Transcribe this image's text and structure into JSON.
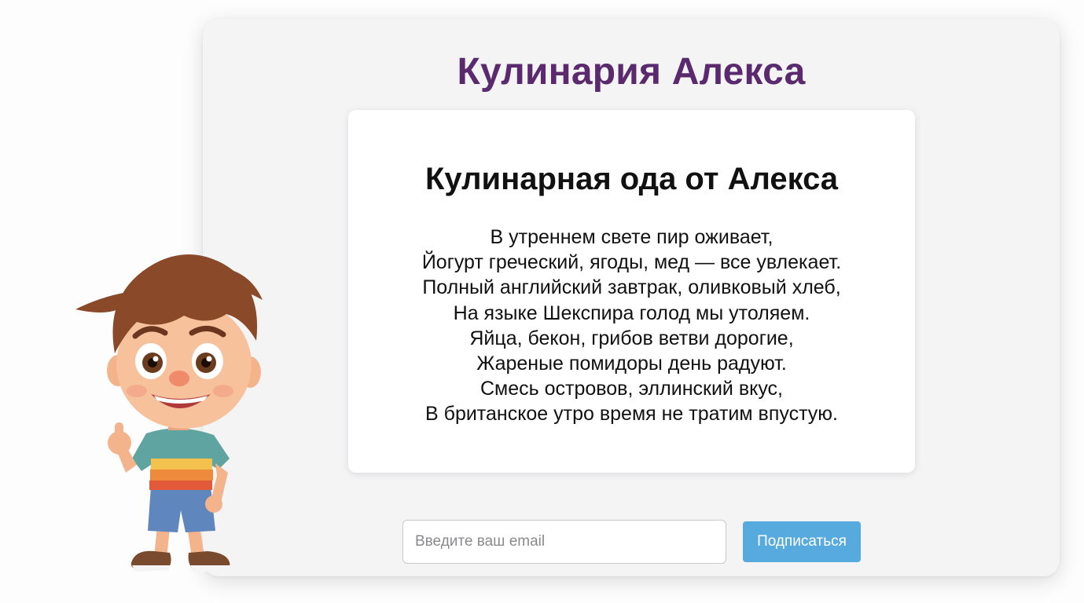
{
  "header": {
    "title": "Кулинария Алекса"
  },
  "poem": {
    "title": "Кулинарная ода от Алекса",
    "lines": [
      "В утреннем свете пир оживает,",
      "Йогурт греческий, ягоды, мед — все увлекает.",
      "Полный английский завтрак, оливковый хлеб,",
      "На языке Шекспира голод мы утоляем.",
      "Яйца, бекон, грибов ветви дорогие,",
      "Жареные помидоры день радуют.",
      "Смесь островов, эллинский вкус,",
      "В британское утро время не тратим впустую."
    ]
  },
  "subscribe": {
    "email_placeholder": "Введите ваш email",
    "button_label": "Подписаться"
  },
  "colors": {
    "title": "#5b2a6e",
    "button": "#57aadd",
    "panel": "#f4f4f5"
  },
  "mascot": {
    "icon": "cartoon-boy-thumbs-up"
  }
}
